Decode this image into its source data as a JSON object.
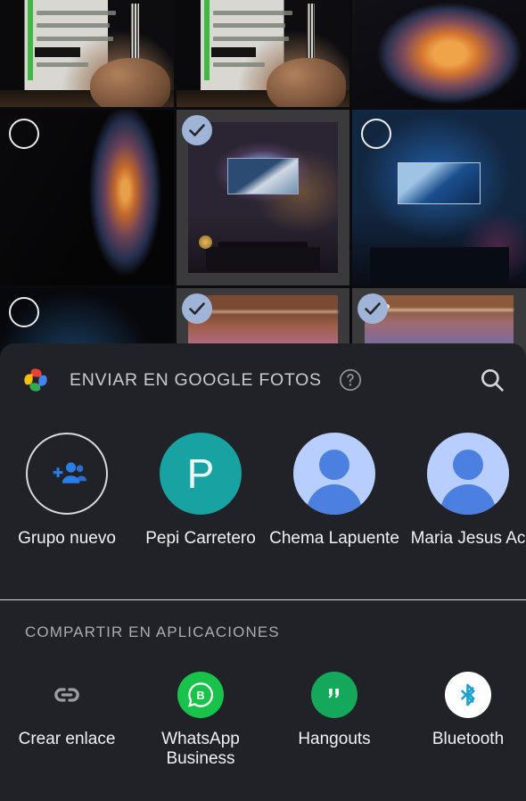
{
  "photo_grid": {
    "cells": [
      {
        "id": "boarding-pass-1",
        "selected": false,
        "badge_visible": false,
        "kind": "pass"
      },
      {
        "id": "boarding-pass-2",
        "selected": false,
        "badge_visible": false,
        "kind": "pass"
      },
      {
        "id": "airplane-window-sunset",
        "selected": false,
        "badge_visible": false,
        "kind": "win1"
      },
      {
        "id": "airplane-window-dark",
        "selected": false,
        "badge_visible": true,
        "kind": "win2"
      },
      {
        "id": "ambilight-tv-warm-room",
        "selected": true,
        "badge_visible": true,
        "kind": "tv1"
      },
      {
        "id": "ambilight-tv-blue-room",
        "selected": false,
        "badge_visible": true,
        "kind": "tv2"
      },
      {
        "id": "night-scene",
        "selected": false,
        "badge_visible": true,
        "kind": "n1"
      },
      {
        "id": "sunset-sea-1",
        "selected": true,
        "badge_visible": true,
        "kind": "sun1"
      },
      {
        "id": "sunset-sea-2",
        "selected": true,
        "badge_visible": true,
        "kind": "sun2"
      }
    ]
  },
  "sheet": {
    "header": {
      "logo_icon": "google-photos-logo-icon",
      "title": "ENVIAR EN GOOGLE FOTOS",
      "help_icon": "help-circle-icon",
      "search_icon": "search-icon"
    },
    "people": [
      {
        "name": "Grupo nuevo",
        "avatar_type": "add-group",
        "icon": "add-people-icon"
      },
      {
        "name": "Pepi Carretero",
        "avatar_type": "initial",
        "initial": "P",
        "color": "#18a2a2"
      },
      {
        "name": "Chema Lapuente",
        "avatar_type": "generic",
        "color": "#b7ceff"
      },
      {
        "name": "Maria Jesus Ac",
        "avatar_type": "generic",
        "color": "#b7ceff"
      }
    ],
    "apps_section_title": "COMPARTIR EN APLICACIONES",
    "apps": [
      {
        "name": "Crear enlace",
        "icon": "link-icon",
        "style": "plain"
      },
      {
        "name": "WhatsApp\nBusiness",
        "icon": "whatsapp-business-icon",
        "style": "wa"
      },
      {
        "name": "Hangouts",
        "icon": "hangouts-icon",
        "style": "hg"
      },
      {
        "name": "Bluetooth",
        "icon": "bluetooth-icon",
        "style": "bt"
      }
    ]
  },
  "colors": {
    "sheet_bg": "#212227",
    "accent_teal": "#18a2a2",
    "avatar_blue": "#b7ceff",
    "whatsapp_green": "#19c24a",
    "hangouts_green": "#13a85a",
    "selection_badge": "#9fb4d6"
  }
}
